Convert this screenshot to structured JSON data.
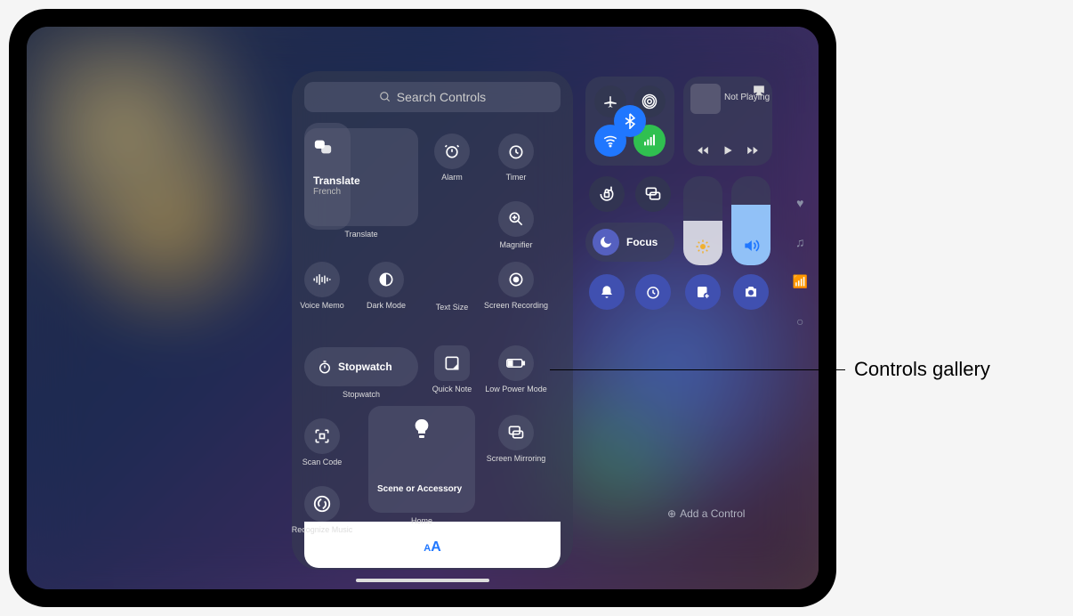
{
  "search": {
    "placeholder": "Search Controls"
  },
  "gallery": {
    "translate": {
      "title": "Translate",
      "subtitle": "French",
      "label": "Translate"
    },
    "alarm": "Alarm",
    "timer": "Timer",
    "magnifier": "Magnifier",
    "voice_memo": "Voice Memo",
    "dark_mode": "Dark Mode",
    "text_size": "Text Size",
    "screen_recording": "Screen Recording",
    "stopwatch_inline": "Stopwatch",
    "stopwatch": "Stopwatch",
    "quick_note": "Quick Note",
    "low_power": "Low Power Mode",
    "scan_code": "Scan Code",
    "home_scene": "Scene or Accessory",
    "home": "Home",
    "screen_mirroring": "Screen Mirroring",
    "recognize_music": "Recognize Music"
  },
  "control_center": {
    "now_playing": "Not Playing",
    "focus": "Focus",
    "add_control": "Add a Control"
  },
  "callout": "Controls gallery"
}
